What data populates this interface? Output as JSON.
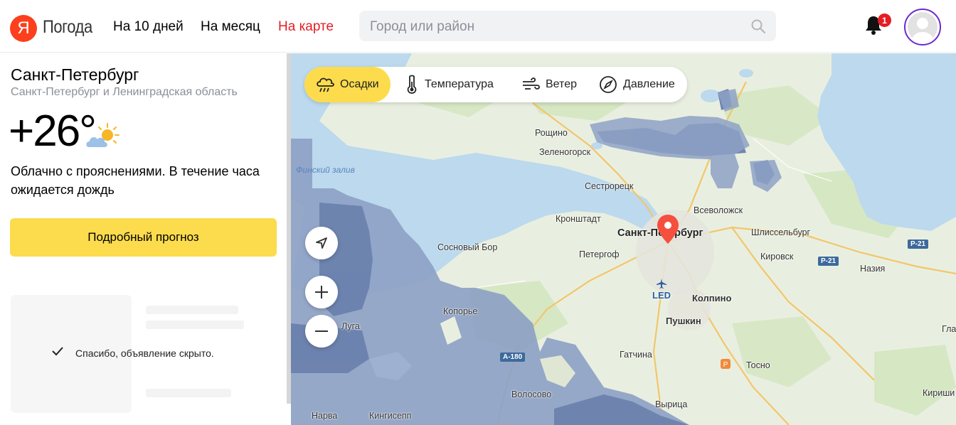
{
  "header": {
    "logo_letter": "Я",
    "logo_text": "Погода",
    "nav": [
      {
        "label": "На 10 дней",
        "active": false
      },
      {
        "label": "На месяц",
        "active": false
      },
      {
        "label": "На карте",
        "active": true
      }
    ],
    "search_placeholder": "Город или район",
    "notifications_count": "1"
  },
  "location": {
    "city": "Санкт-Петербург",
    "region": "Санкт-Петербург и Ленинградская область"
  },
  "current": {
    "temperature": "+26°",
    "weather_icon": "partly-cloudy-icon",
    "description": "Облачно с прояснениями. В течение часа ожидается дождь"
  },
  "forecast_button": "Подробный прогноз",
  "ad": {
    "hidden_message": "Спасибо, объявление скрыто."
  },
  "map": {
    "layers": [
      {
        "label": "Осадки",
        "icon": "precipitation-icon",
        "active": true
      },
      {
        "label": "Температура",
        "icon": "thermometer-icon",
        "active": false
      },
      {
        "label": "Ветер",
        "icon": "wind-icon",
        "active": false
      },
      {
        "label": "Давление",
        "icon": "pressure-icon",
        "active": false
      }
    ],
    "controls": [
      "locate-icon",
      "zoom-in-icon",
      "zoom-out-icon"
    ],
    "labels": {
      "gulf": "Финский залив",
      "roshchino": "Рощино",
      "zelenogorsk": "Зеленогорск",
      "sestroretsk": "Сестрорецк",
      "kronshtadt": "Кронштадт",
      "spb": "Санкт-Петербург",
      "vsevolozhsk": "Всеволожск",
      "shlisselburg": "Шлиссельбург",
      "sosnovy_bor": "Сосновый Бор",
      "petergof": "Петергоф",
      "kirovsk": "Кировск",
      "nazia": "Назия",
      "led": "LED",
      "kolpino": "Колпино",
      "koporye": "Копорье",
      "pushkin": "Пушкин",
      "luga": "Луга",
      "gatchina": "Гатчина",
      "tosno": "Тосно",
      "volosovo": "Волосово",
      "vyritsa": "Вырица",
      "narva": "Нарва",
      "kingisepp": "Кингисепп",
      "kirishi": "Кириши",
      "gla": "Гла"
    },
    "roads": {
      "p21a": "Р-21",
      "p21b": "Р-21",
      "a180": "А-180"
    },
    "colors": {
      "water": "#bcd9ee",
      "land": "#e9efe0",
      "rain_light": "#8ea2c6",
      "rain_dark": "#6b82ae",
      "accent": "#fcdc4d"
    }
  }
}
